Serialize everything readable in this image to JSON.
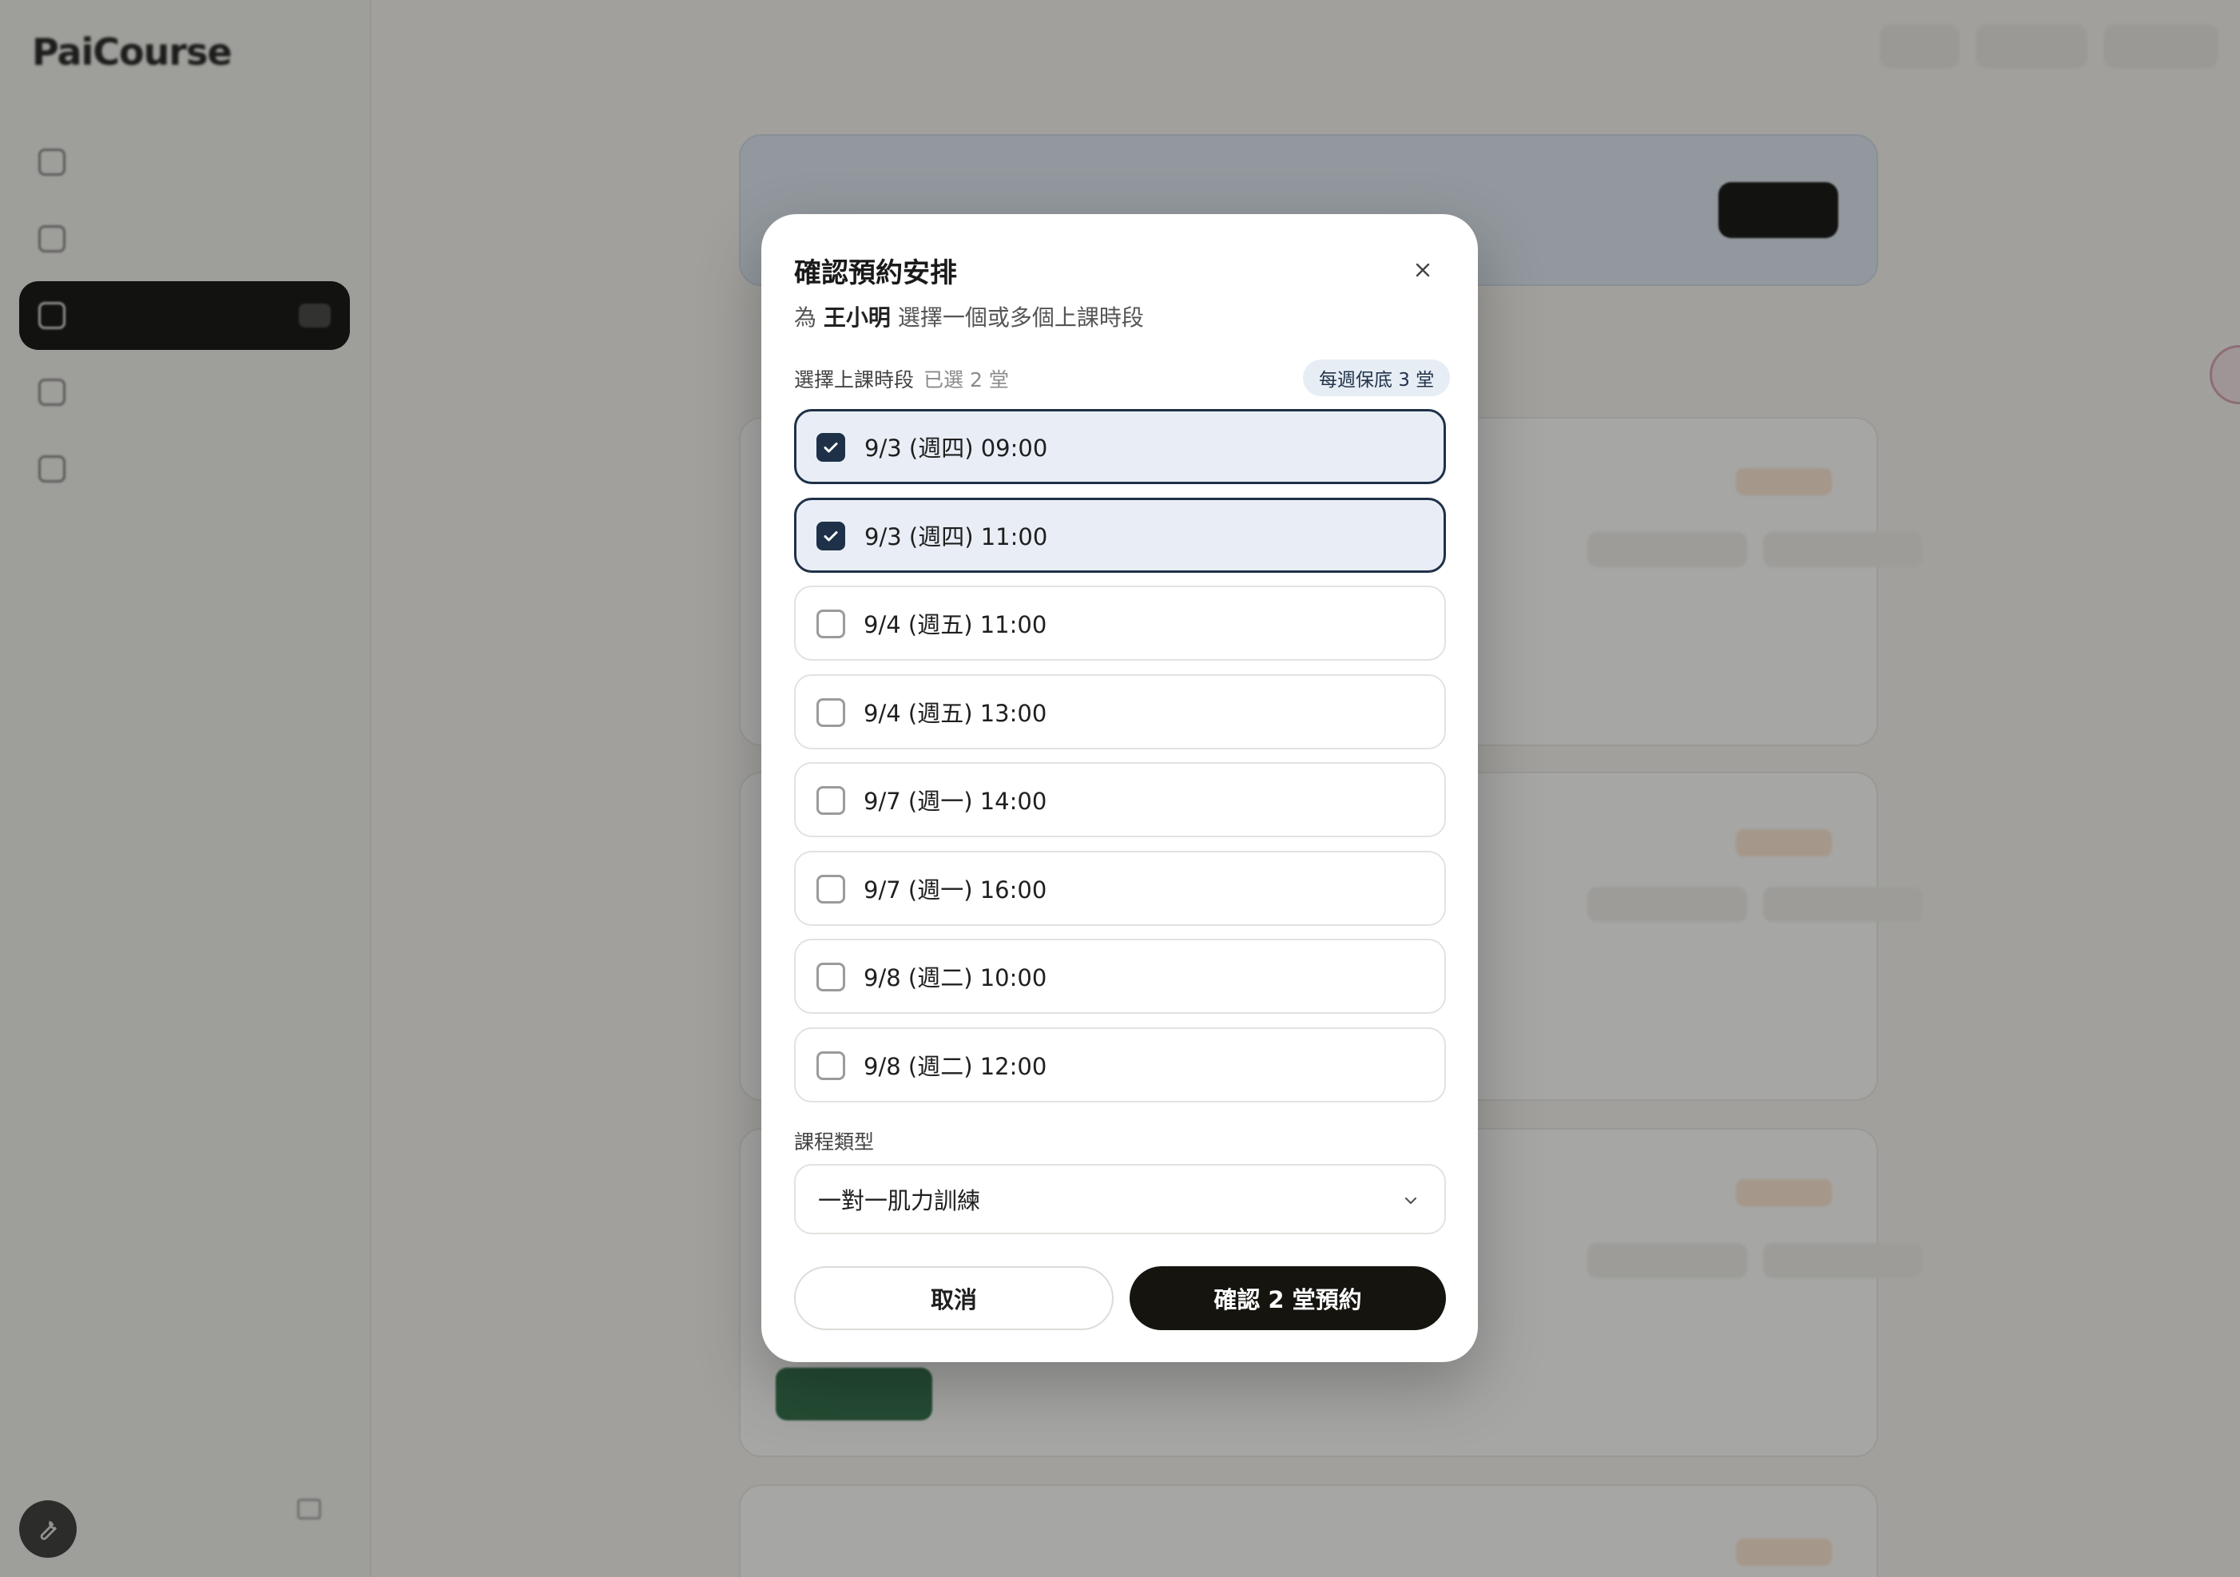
{
  "sidebar": {
    "brand": "PaiCourse",
    "items": [
      {
        "icon": "calendar-icon",
        "active": false
      },
      {
        "icon": "grid-icon",
        "active": false
      },
      {
        "icon": "inbox-icon",
        "active": true
      },
      {
        "icon": "users-icon",
        "active": false
      },
      {
        "icon": "gear-icon",
        "active": false
      }
    ],
    "tool_icon": "wrench-icon"
  },
  "modal": {
    "title": "確認預約安排",
    "subtitle_prefix": "為 ",
    "student_name": "王小明",
    "subtitle_suffix": " 選擇一個或多個上課時段",
    "slots_label": "選擇上課時段",
    "selected_count_text": "已選 2 堂",
    "weekly_minimum_badge": "每週保底 3 堂",
    "slots": [
      {
        "label": "9/3 (週四) 09:00",
        "checked": true
      },
      {
        "label": "9/3 (週四) 11:00",
        "checked": true
      },
      {
        "label": "9/4 (週五) 11:00",
        "checked": false
      },
      {
        "label": "9/4 (週五) 13:00",
        "checked": false
      },
      {
        "label": "9/7 (週一) 14:00",
        "checked": false
      },
      {
        "label": "9/7 (週一) 16:00",
        "checked": false
      },
      {
        "label": "9/8 (週二) 10:00",
        "checked": false
      },
      {
        "label": "9/8 (週二) 12:00",
        "checked": false
      }
    ],
    "course_type_label": "課程類型",
    "course_type_value": "一對一肌力訓練",
    "cancel_label": "取消",
    "confirm_label": "確認 2 堂預約"
  },
  "colors": {
    "primary_dark": "#1e3148",
    "selected_bg": "#e9eef6",
    "confirm_button": "#15140f",
    "badge_bg": "#e6edf5"
  }
}
